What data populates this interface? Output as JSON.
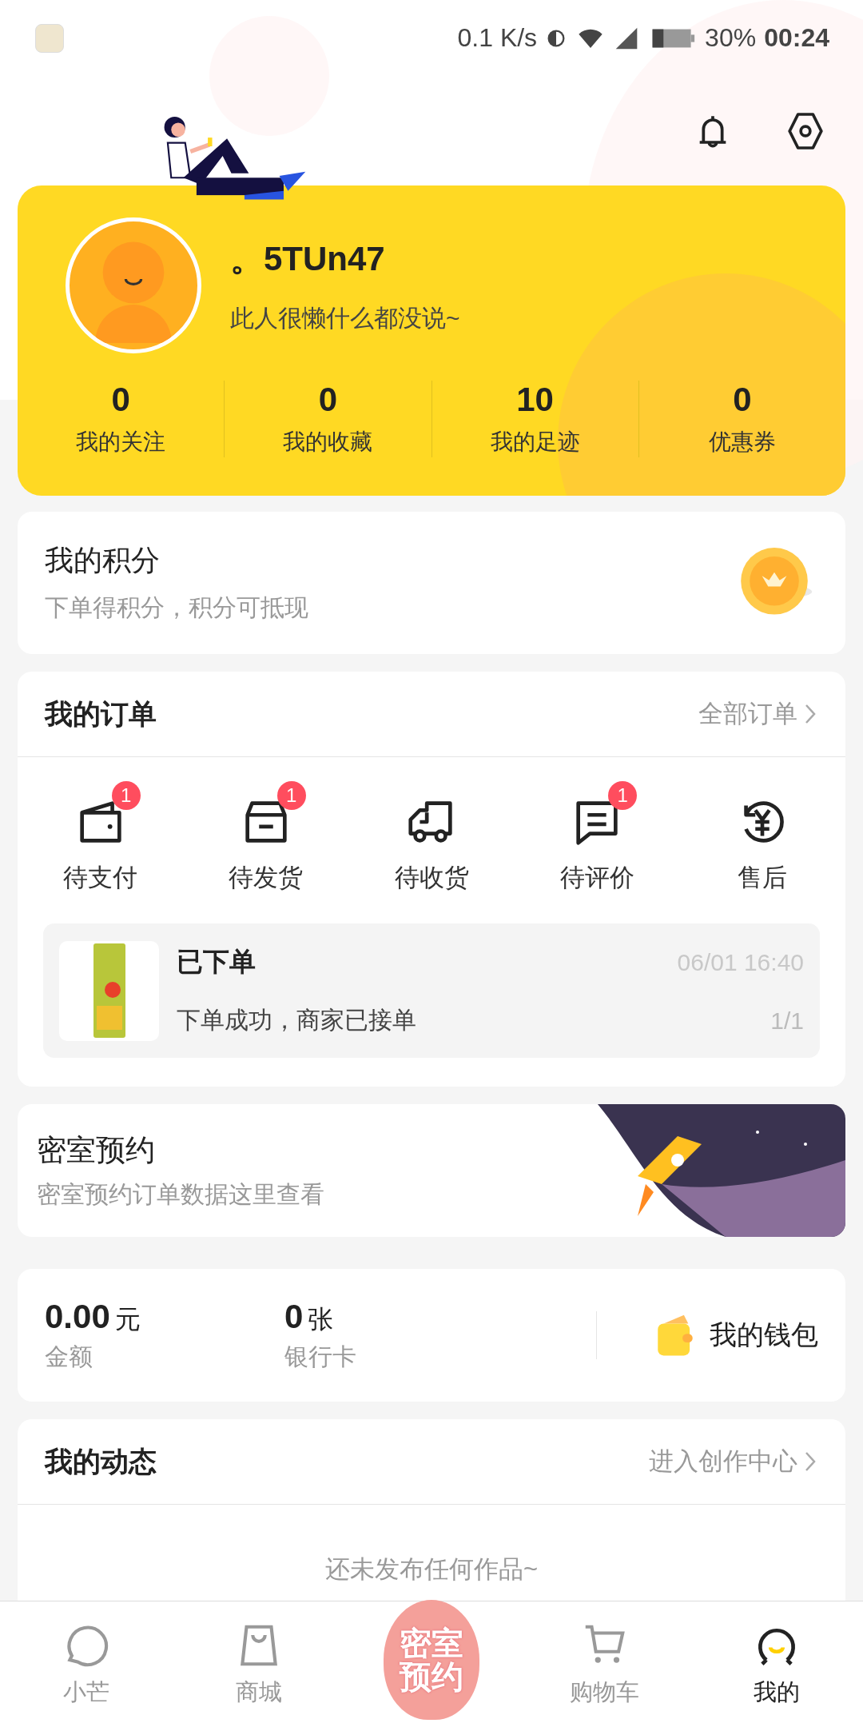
{
  "status_bar": {
    "network_speed": "0.1 K/s",
    "battery": "30%",
    "time": "00:24"
  },
  "profile": {
    "name": "。5TUn47",
    "bio": "此人很懒什么都没说~",
    "stats": [
      {
        "value": "0",
        "label": "我的关注"
      },
      {
        "value": "0",
        "label": "我的收藏"
      },
      {
        "value": "10",
        "label": "我的足迹"
      },
      {
        "value": "0",
        "label": "优惠券"
      }
    ]
  },
  "points": {
    "title": "我的积分",
    "subtitle": "下单得积分，积分可抵现"
  },
  "orders": {
    "title": "我的订单",
    "link": "全部订单",
    "statuses": [
      {
        "label": "待支付",
        "badge": "1",
        "kind": "pay"
      },
      {
        "label": "待发货",
        "badge": "1",
        "kind": "ship"
      },
      {
        "label": "待收货",
        "kind": "receive"
      },
      {
        "label": "待评价",
        "badge": "1",
        "kind": "review"
      },
      {
        "label": "售后",
        "kind": "refund"
      }
    ],
    "latest": {
      "status": "已下单",
      "time": "06/01 16:40",
      "message": "下单成功，商家已接单",
      "count": "1/1"
    }
  },
  "escape_room": {
    "title": "密室预约",
    "subtitle": "密室预约订单数据这里查看"
  },
  "wallet": {
    "balance": {
      "value": "0.00",
      "unit": "元",
      "label": "金额"
    },
    "cards": {
      "value": "0",
      "unit": "张",
      "label": "银行卡"
    },
    "link": "我的钱包"
  },
  "feed": {
    "title": "我的动态",
    "link": "进入创作中心",
    "empty": "还未发布任何作品~"
  },
  "nav": [
    {
      "label": "小芒",
      "kind": "chat",
      "selected": false
    },
    {
      "label": "商城",
      "kind": "bag",
      "selected": false
    },
    {
      "label": "密室预约",
      "kind": "logo",
      "selected": false
    },
    {
      "label": "购物车",
      "kind": "cart",
      "selected": false
    },
    {
      "label": "我的",
      "kind": "me",
      "selected": true
    }
  ]
}
